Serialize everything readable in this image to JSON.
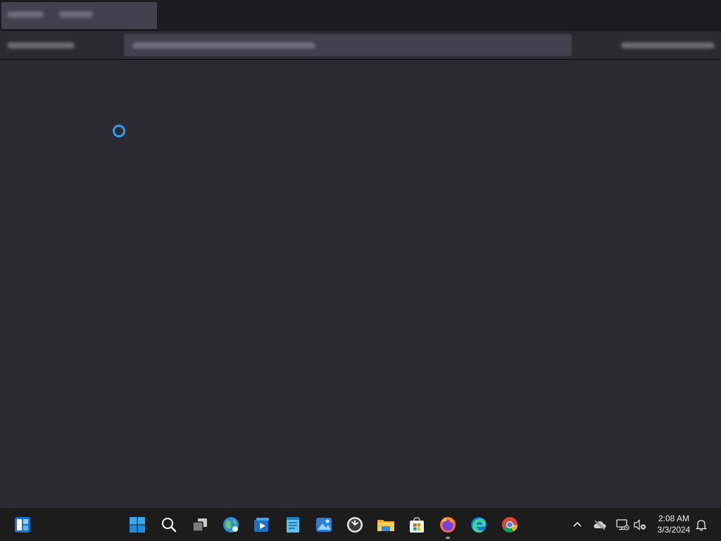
{
  "taskbar": {
    "pinned": [
      {
        "name": "widgets-icon"
      },
      {
        "name": "start-icon"
      },
      {
        "name": "search-icon"
      },
      {
        "name": "task-view-icon"
      },
      {
        "name": "weather-globe-icon"
      },
      {
        "name": "media-player-icon"
      },
      {
        "name": "notepad-icon"
      },
      {
        "name": "photos-icon"
      },
      {
        "name": "clock-icon"
      },
      {
        "name": "file-explorer-icon"
      },
      {
        "name": "store-icon"
      },
      {
        "name": "firefox-icon"
      },
      {
        "name": "edge-icon"
      },
      {
        "name": "chrome-icon"
      }
    ],
    "tray": {
      "chevron": "chevron-up-icon",
      "cloud": "cloud-offline-icon",
      "network": "network-icon",
      "volume": "volume-muted-icon",
      "bell": "bell-icon"
    },
    "clock": {
      "time": "2:08 AM",
      "date": "3/3/2024"
    }
  },
  "colors": {
    "accent": "#2fa0ea",
    "windows_blue": "#1e90ff"
  }
}
